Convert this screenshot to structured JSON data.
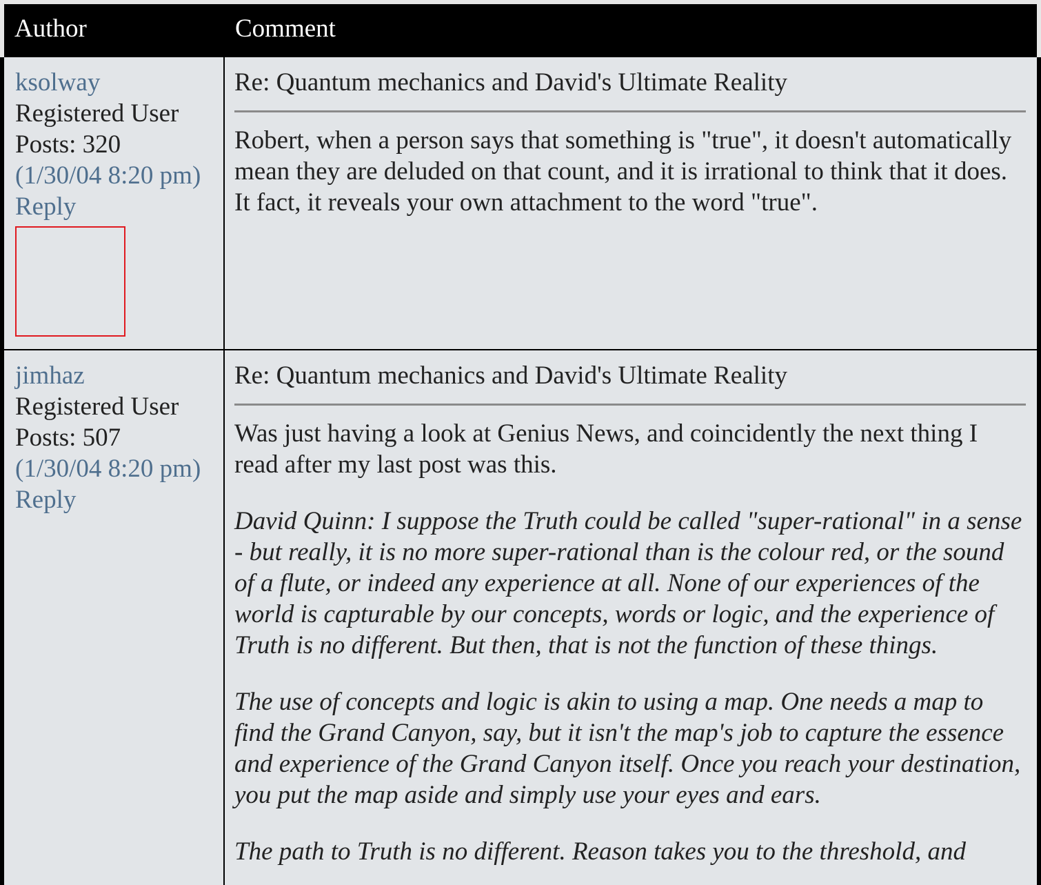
{
  "header": {
    "author_label": "Author",
    "comment_label": "Comment"
  },
  "posts": [
    {
      "author": "ksolway",
      "role": "Registered User",
      "posts_count": "Posts: 320",
      "timestamp": "(1/30/04 8:20 pm)",
      "reply_label": "Reply",
      "subject": "Re: Quantum mechanics and David's Ultimate Reality",
      "paragraphs": [
        "Robert, when a person says that something is \"true\", it doesn't automatically mean they are deluded on that count, and it is irrational to think that it does. It fact, it reveals your own attachment to the word \"true\"."
      ],
      "avatar_border_color": "#e0191f"
    },
    {
      "author": "jimhaz",
      "role": "Registered User",
      "posts_count": "Posts: 507",
      "timestamp": "(1/30/04 8:20 pm)",
      "reply_label": "Reply",
      "subject": "Re: Quantum mechanics and David's Ultimate Reality",
      "paragraphs": [
        "Was just having a look at Genius News, and coincidently the next thing I read after my last post was this."
      ],
      "quote_paragraphs": [
        "David Quinn: I suppose the Truth could be called \"super-rational\" in a sense - but really, it is no more super-rational than is the colour red, or the sound of a flute, or indeed any experience at all. None of our experiences of the world is capturable by our concepts, words or logic, and the experience of Truth is no different. But then, that is not the function of these things.",
        "The use of concepts and logic is akin to using a map. One needs a map to find the Grand Canyon, say, but it isn't the map's job to capture the essence and experience of the Grand Canyon itself. Once you reach your destination, you put the map aside and simply use your eyes and ears.",
        "The path to Truth is no different. Reason takes you to the threshold, and"
      ]
    }
  ],
  "colors": {
    "header_bg": "#000000",
    "row_bg": "#e2e5e8",
    "link": "#4f6f8e",
    "divider": "#8a8a8a"
  }
}
